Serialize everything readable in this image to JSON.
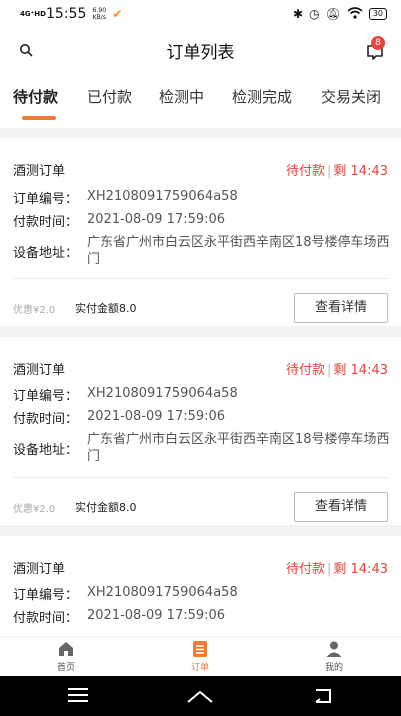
{
  "status_bar": {
    "network": "4G⁺HD",
    "time": "15:55",
    "speed_value": "6.90",
    "speed_unit": "KB/s",
    "battery": "30"
  },
  "header": {
    "title": "订单列表",
    "message_badge": "8"
  },
  "tabs": [
    {
      "label": "待付款",
      "active": true
    },
    {
      "label": "已付款",
      "active": false
    },
    {
      "label": "检测中",
      "active": false
    },
    {
      "label": "检测完成",
      "active": false
    },
    {
      "label": "交易关闭",
      "active": false
    }
  ],
  "orders": [
    {
      "name": "酒测订单",
      "status": "待付款",
      "countdown_prefix": "剩",
      "countdown": "14:43",
      "order_no_label": "订单编号：",
      "order_no": "XH2108091759064a58",
      "pay_time_label": "付款时间：",
      "pay_time": "2021-08-09 17:59:06",
      "address_label": "设备地址：",
      "address": "广东省广州市白云区永平街西辛南区18号楼停车场西门",
      "discount": "优惠¥2.0",
      "paid_amount": "实付金额8.0",
      "detail_button": "查看详情"
    },
    {
      "name": "酒测订单",
      "status": "待付款",
      "countdown_prefix": "剩",
      "countdown": "14:43",
      "order_no_label": "订单编号：",
      "order_no": "XH2108091759064a58",
      "pay_time_label": "付款时间：",
      "pay_time": "2021-08-09 17:59:06",
      "address_label": "设备地址：",
      "address": "广东省广州市白云区永平街西辛南区18号楼停车场西门",
      "discount": "优惠¥2.0",
      "paid_amount": "实付金额8.0",
      "detail_button": "查看详情"
    },
    {
      "name": "酒测订单",
      "status": "待付款",
      "countdown_prefix": "剩",
      "countdown": "14:43",
      "order_no_label": "订单编号：",
      "order_no": "XH2108091759064a58",
      "pay_time_label": "付款时间：",
      "pay_time": "2021-08-09 17:59:06"
    }
  ],
  "bottom_nav": [
    {
      "label": "首页",
      "icon": "home-icon",
      "active": false
    },
    {
      "label": "订单",
      "icon": "order-icon",
      "active": true
    },
    {
      "label": "我的",
      "icon": "profile-icon",
      "active": false
    }
  ],
  "colors": {
    "accent": "#f07a36",
    "status_red": "#e8453c"
  }
}
